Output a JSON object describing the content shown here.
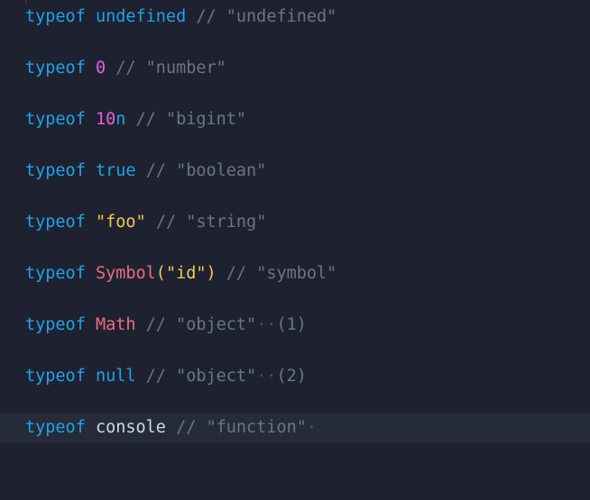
{
  "colors": {
    "background": "#1e2230",
    "current_line": "#262b39",
    "keyword": "#1fa3e8",
    "number": "#e85fd9",
    "string": "#f2c94c",
    "global_object": "#f06b83",
    "comment": "#6b7486"
  },
  "lines": [
    {
      "keyword": "typeof",
      "operand": "undefined",
      "comment": "// \"undefined\""
    },
    {
      "keyword": "typeof",
      "operand": "0",
      "comment": "// \"number\""
    },
    {
      "keyword": "typeof",
      "operand_num": "10",
      "operand_suffix": "n",
      "comment": "// \"bigint\""
    },
    {
      "keyword": "typeof",
      "operand": "true",
      "comment": "// \"boolean\""
    },
    {
      "keyword": "typeof",
      "operand": "\"foo\"",
      "comment": "// \"string\""
    },
    {
      "keyword": "typeof",
      "operand_fn": "Symbol",
      "open_paren": "(",
      "operand_arg": "\"id\"",
      "close_paren": ")",
      "comment": "// \"symbol\""
    },
    {
      "keyword": "typeof",
      "operand": "Math",
      "comment": "// \"object\"",
      "whitespace_marks": "··",
      "note": "(1)"
    },
    {
      "keyword": "typeof",
      "operand": "null",
      "comment": "// \"object\"",
      "whitespace_marks": "··",
      "note": "(2)"
    },
    {
      "keyword": "typeof",
      "operand": "console",
      "comment": "// \"function\"",
      "whitespace_marks": "·"
    }
  ]
}
